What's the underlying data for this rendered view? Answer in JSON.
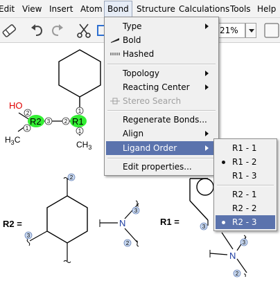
{
  "menubar": {
    "items": [
      {
        "label": "Edit",
        "key": "E"
      },
      {
        "label": "View",
        "key": "V"
      },
      {
        "label": "Insert",
        "key": "I"
      },
      {
        "label": "Atom",
        "key": "A"
      },
      {
        "label": "Bond",
        "key": "B"
      },
      {
        "label": "Structure",
        "key": "S"
      },
      {
        "label": "Calculations",
        "key": "C"
      },
      {
        "label": "Tools",
        "key": "T"
      },
      {
        "label": "Help",
        "key": "H"
      }
    ]
  },
  "toolbar": {
    "zoom_value": "21%",
    "icons": [
      "eraser-icon",
      "undo-icon",
      "redo-icon",
      "cut-icon"
    ]
  },
  "bond_menu": {
    "items": [
      {
        "label": "Type",
        "submenu": true
      },
      {
        "label": "Bold",
        "icon": "bold-bond-icon"
      },
      {
        "label": "Hashed",
        "icon": "hashed-bond-icon"
      },
      {
        "label": "Topology",
        "submenu": true
      },
      {
        "label": "Reacting Center",
        "submenu": true
      },
      {
        "label": "Stereo Search",
        "disabled": true,
        "icon": "stereo-search-icon"
      },
      {
        "label": "Regenerate Bonds..."
      },
      {
        "label": "Align",
        "submenu": true
      },
      {
        "label": "Ligand Order",
        "submenu": true,
        "selected": true
      },
      {
        "label": "Edit properties..."
      }
    ]
  },
  "ligand_order_menu": {
    "items": [
      {
        "label": "R1 - 1"
      },
      {
        "label": "R1 - 2",
        "checked": true
      },
      {
        "label": "R1 - 3"
      },
      {
        "label": "R2 - 1"
      },
      {
        "label": "R2 - 2"
      },
      {
        "label": "R2 - 3",
        "checked": true,
        "selected": true
      }
    ]
  },
  "canvas": {
    "main_structure": {
      "atoms": [
        "HO",
        "R2",
        "R1",
        "H3C",
        "CH3"
      ],
      "h3c_main": "H",
      "h3c_sub": "3",
      "h3c_tail": "C",
      "ch3_main": "CH",
      "ch3_sub": "3",
      "bond_numbers": [
        "1",
        "2",
        "3",
        "1",
        "2",
        "3",
        "1"
      ]
    },
    "r2_definition": {
      "label": "R2 =",
      "attachment_numbers": [
        "2",
        "3",
        "3",
        "2"
      ],
      "atom": "N"
    },
    "r1_definition": {
      "label": "R1 =",
      "attachment_numbers": [
        "3",
        "3",
        "2"
      ],
      "atom": "N"
    },
    "colors": {
      "highlight": "#33ee33",
      "oxygen": "#e00000",
      "nitrogen": "#1a3aa0",
      "marker_fill": "#c8d8f0",
      "marker_stroke": "#6b85b8"
    }
  }
}
